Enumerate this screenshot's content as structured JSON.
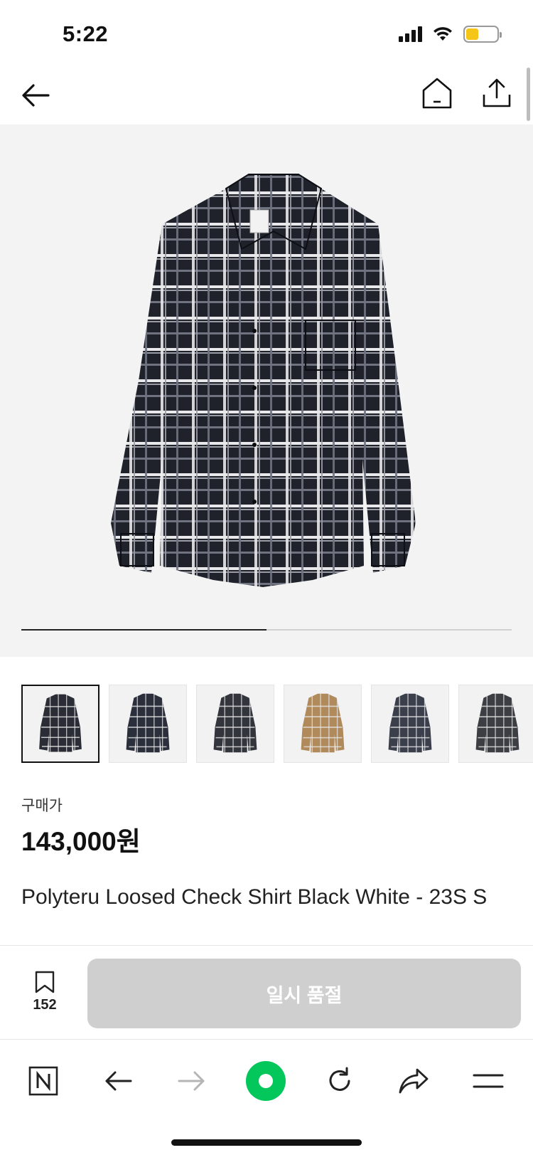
{
  "status_bar": {
    "time": "5:22",
    "battery_level": 0.4,
    "battery_color": "#f5c518"
  },
  "top_nav": {
    "back_icon": "arrow-left-icon",
    "home_icon": "home-icon",
    "share_icon": "share-upload-icon"
  },
  "hero": {
    "image": "plaid-shirt-black-white",
    "carousel_progress": 0.5
  },
  "thumbnails": [
    {
      "name": "plaid-shirt-black-white",
      "color": "#2a2d35",
      "selected": true
    },
    {
      "name": "plaid-shirt-black-navy",
      "color": "#2b2f3c",
      "selected": false
    },
    {
      "name": "plaid-shirt-black-white-alt",
      "color": "#33353c",
      "selected": false
    },
    {
      "name": "plaid-shirt-brown-beige",
      "color": "#b08a5a",
      "selected": false
    },
    {
      "name": "plaid-shirt-navy-white",
      "color": "#3b3f4c",
      "selected": false
    },
    {
      "name": "plaid-shirt-grey-black",
      "color": "#3c3e44",
      "selected": false
    }
  ],
  "product": {
    "price_label": "구매가",
    "price": "143,000원",
    "title": "Polyteru Loosed Check Shirt Black White - 23S S"
  },
  "action_bar": {
    "bookmark_count": "152",
    "primary_button": "일시 품절",
    "primary_button_color": "#cfcfcf"
  },
  "browser_bar": {
    "items": [
      "naver-n-icon",
      "back-arrow-icon",
      "forward-arrow-icon",
      "green-circle-icon",
      "reload-icon",
      "share-icon",
      "menu-icon"
    ],
    "accent_color": "#03c75a"
  }
}
